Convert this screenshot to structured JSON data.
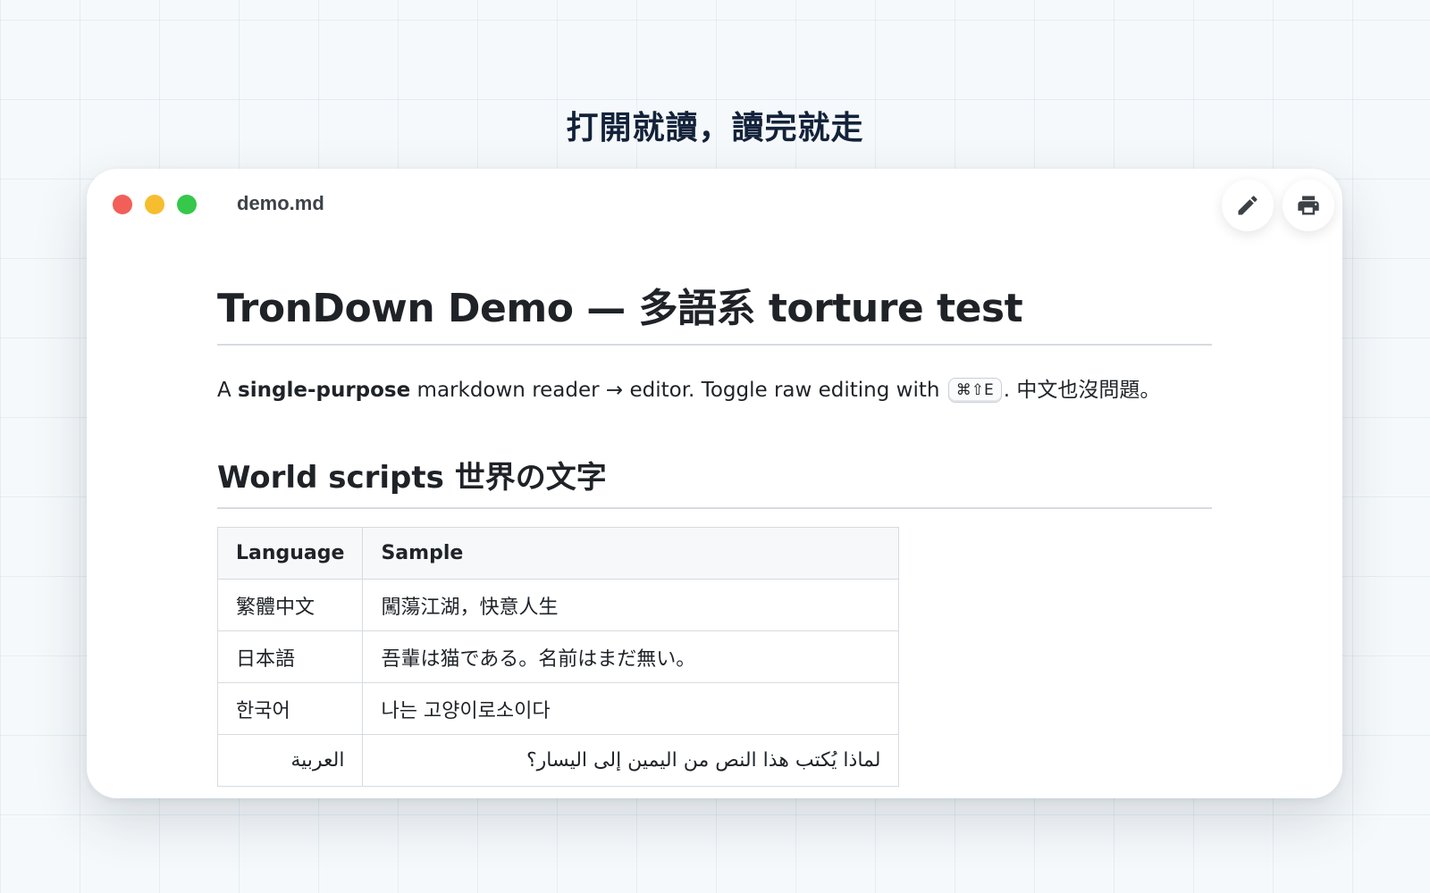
{
  "tagline": "打開就讀，讀完就走",
  "window": {
    "filename": "demo.md",
    "toolbar": [
      {
        "icon": "pencil-icon",
        "action": "edit"
      },
      {
        "icon": "printer-icon",
        "action": "print"
      }
    ]
  },
  "document": {
    "title": "TronDown Demo — 多語系 torture test",
    "lead": {
      "prefix": "A ",
      "bold": "single-purpose",
      "middle": " markdown reader → editor. Toggle raw editing with ",
      "kbd": "⌘⇧E",
      "suffix": ". 中文也沒問題。"
    },
    "section_title": "World scripts 世界の文字",
    "table": {
      "headers": [
        "Language",
        "Sample"
      ],
      "rows": [
        {
          "language": "繁體中文",
          "sample": "闖蕩江湖，快意人生"
        },
        {
          "language": "日本語",
          "sample": "吾輩は猫である。名前はまだ無い。"
        },
        {
          "language": "한국어",
          "sample": "나는 고양이로소이다"
        },
        {
          "language": "العربية",
          "sample": "لماذا يُكتب هذا النص من اليمين إلى اليسار؟"
        }
      ]
    }
  }
}
